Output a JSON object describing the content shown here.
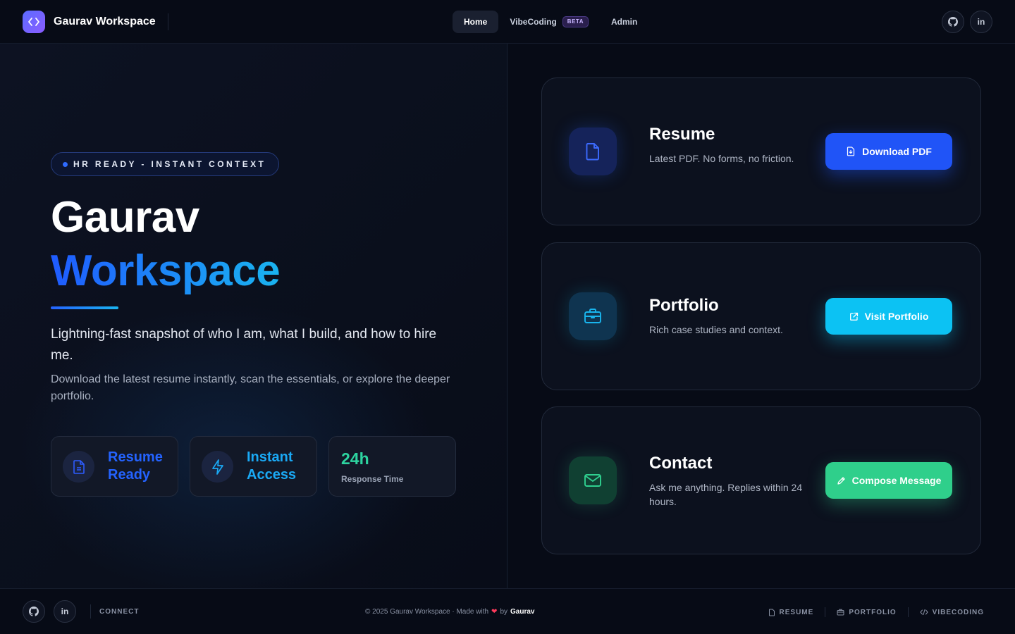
{
  "nav": {
    "brand": "Gaurav Workspace",
    "links": [
      "Home",
      "VibeCoding",
      "Admin"
    ],
    "beta_badge": "BETA",
    "linkedin_label": "in"
  },
  "hero": {
    "pill": "HR READY - INSTANT CONTEXT",
    "title_line1": "Gaurav",
    "title_line2": "Workspace",
    "lead": "Lightning-fast snapshot of who I am, what I build, and how to hire me.",
    "sub": "Download the latest resume instantly, scan the essentials, or explore the deeper portfolio.",
    "stats": [
      {
        "line1": "Resume",
        "line2": "Ready",
        "color": "#2463ff"
      },
      {
        "line1": "Instant",
        "line2": "Access",
        "color": "#1aa9f5"
      },
      {
        "value": "24h",
        "label": "Response Time",
        "color": "#2dd4a0"
      }
    ]
  },
  "cards": [
    {
      "title": "Resume",
      "desc": "Latest PDF. No forms, no friction.",
      "button": "Download PDF",
      "color": "#2563ff"
    },
    {
      "title": "Portfolio",
      "desc": "Rich case studies and context.",
      "button": "Visit Portfolio",
      "color": "#0cc2f3"
    },
    {
      "title": "Contact",
      "desc": "Ask me anything. Replies within 24 hours.",
      "button": "Compose Message",
      "color": "#2fd08f"
    }
  ],
  "footer": {
    "connect": "CONNECT",
    "copyright": "© 2025 Gaurav Workspace · Made with",
    "by": "by",
    "author": "Gaurav",
    "linkedin_label": "in",
    "links": [
      "RESUME",
      "PORTFOLIO",
      "VIBECODING"
    ]
  }
}
